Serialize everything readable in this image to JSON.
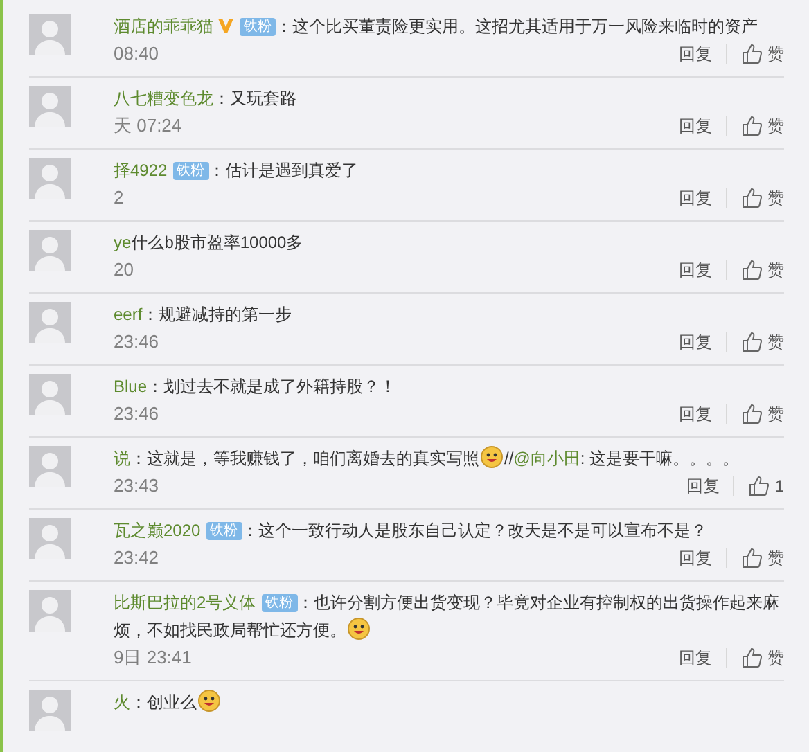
{
  "comments": [
    {
      "name": "酒店的乖乖猫",
      "verified": true,
      "badge": "铁粉",
      "body": [
        {
          "kind": "text",
          "text": "：这个比买董责险更实用。这招尤其适用于万一风险来临时的资产"
        }
      ],
      "time": "08:40",
      "reply": "回复",
      "like": "赞"
    },
    {
      "name": "八七糟变色龙",
      "verified": false,
      "body": [
        {
          "kind": "text",
          "text": "：又玩套路"
        }
      ],
      "time": "天 07:24",
      "reply": "回复",
      "like": "赞"
    },
    {
      "name": "择4922",
      "verified": false,
      "badge": "铁粉",
      "body": [
        {
          "kind": "text",
          "text": "：估计是遇到真爱了"
        }
      ],
      "time": "2",
      "reply": "回复",
      "like": "赞"
    },
    {
      "name": "ye",
      "verified": false,
      "body": [
        {
          "kind": "text",
          "text": "什么b股市盈率10000多"
        }
      ],
      "time": "20",
      "reply": "回复",
      "like": "赞"
    },
    {
      "name": "eerf",
      "verified": false,
      "body": [
        {
          "kind": "text",
          "text": "：规避减持的第一步"
        }
      ],
      "time": "23:46",
      "reply": "回复",
      "like": "赞"
    },
    {
      "name": "Blue",
      "verified": false,
      "body": [
        {
          "kind": "text",
          "text": "：划过去不就是成了外籍持股？！"
        }
      ],
      "time": "23:46",
      "reply": "回复",
      "like": "赞"
    },
    {
      "name": "说",
      "verified": false,
      "body": [
        {
          "kind": "text",
          "text": "：这就是，等我赚钱了，咱们离婚去的真实写照"
        },
        {
          "kind": "emoji"
        },
        {
          "kind": "text",
          "text": "//"
        },
        {
          "kind": "link",
          "text": "@向小田"
        },
        {
          "kind": "text",
          "text": ": 这是要干嘛。。。。"
        }
      ],
      "time": "23:43",
      "reply": "回复",
      "like": "1"
    },
    {
      "name": "瓦之巅2020",
      "verified": false,
      "badge": "铁粉",
      "body": [
        {
          "kind": "text",
          "text": "：这个一致行动人是股东自己认定？改天是不是可以宣布不是？"
        }
      ],
      "time": "23:42",
      "reply": "回复",
      "like": "赞"
    },
    {
      "name": "比斯巴拉的2号义体",
      "verified": false,
      "badge": "铁粉",
      "body": [
        {
          "kind": "text",
          "text": "：也许分割方便出货变现？毕竟对企业有控制权的出货操作起来麻烦，不如找民政局帮忙还方便。"
        },
        {
          "kind": "emoji"
        }
      ],
      "time": "9日 23:41",
      "reply": "回复",
      "like": "赞"
    },
    {
      "name": "火",
      "verified": false,
      "body": [
        {
          "kind": "text",
          "text": "：创业么"
        },
        {
          "kind": "emoji"
        }
      ]
    }
  ]
}
